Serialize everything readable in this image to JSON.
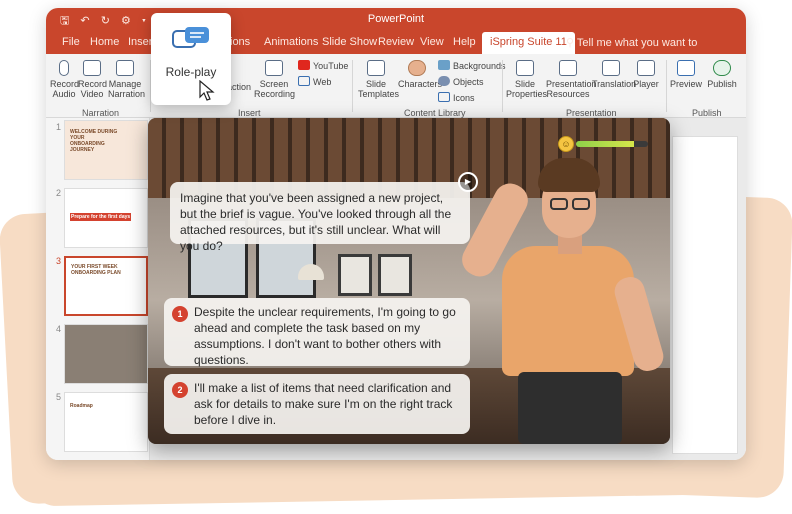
{
  "app": {
    "title": "PowerPoint",
    "quick_access": "🖫 ↶ ↻ ⚙ ▾"
  },
  "tabs": [
    "File",
    "Home",
    "Insert",
    "ions",
    "Animations",
    "Slide Show",
    "Review",
    "View",
    "Help",
    "iSpring Suite 11",
    "Tell me what you want to"
  ],
  "active_tab": "iSpring Suite 11",
  "ribbon": {
    "narration": {
      "record_audio": "Record Audio",
      "record_video": "Record Video",
      "manage_narration": "Manage Narration",
      "group": "Narration"
    },
    "insert": {
      "interaction": "action",
      "screen_recording": "Screen Recording",
      "youtube": "YouTube",
      "web": "Web",
      "group": "Insert"
    },
    "content_library": {
      "slide_templates": "Slide Templates",
      "characters": "Characters",
      "backgrounds": "Backgrounds",
      "objects": "Objects",
      "icons": "Icons",
      "group": "Content Library"
    },
    "presentation": {
      "slide_properties": "Slide Properties",
      "presentation_resources": "Presentation Resources",
      "translation": "Translation",
      "player": "Player",
      "group": "Presentation"
    },
    "publish": {
      "preview": "Preview",
      "publish": "Publish",
      "group": "Publish"
    }
  },
  "callout": {
    "label": "Role-play"
  },
  "thumbnails": [
    {
      "num": "1",
      "title": "WELCOME DURING YOUR ONBOARDING JOURNEY"
    },
    {
      "num": "2",
      "title": "Prepare for the first days"
    },
    {
      "num": "3",
      "title": "YOUR FIRST WEEK ONBOARDING PLAN"
    },
    {
      "num": "4",
      "title": ""
    },
    {
      "num": "5",
      "title": "Roadmap"
    }
  ],
  "current_thumbnail": "3",
  "roleplay": {
    "question": "Imagine that you've been assigned a new project, but the brief is vague. You've looked through all the attached resources, but it's still unclear. What will you do?",
    "options": [
      {
        "num": "1",
        "text": "Despite the unclear requirements, I'm going to go ahead and complete the task based on my assumptions. I don't want to bother others with questions."
      },
      {
        "num": "2",
        "text": "I'll make a list of items that need clarification and ask for details to make sure I'm on the right track before I dive in."
      }
    ],
    "mood_level": 0.8,
    "mood_icon": "smiley-face-icon",
    "play_icon": "play-icon"
  },
  "colors": {
    "brand": "#c9462c",
    "accent_number": "#d4422f",
    "background_shape": "#f7dcc4"
  }
}
